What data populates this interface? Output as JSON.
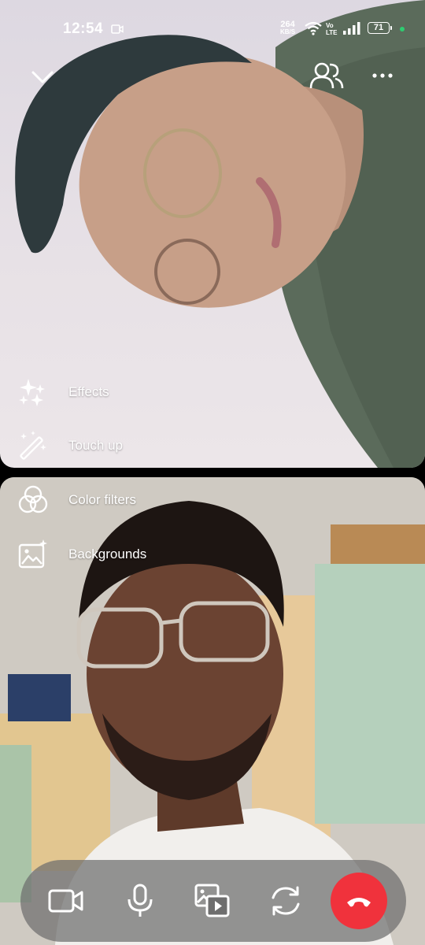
{
  "status_bar": {
    "time": "12:54",
    "speed_value": "264",
    "speed_unit": "KB/S",
    "volte_line1": "Vo",
    "volte_line2": "LTE",
    "battery": "71"
  },
  "top_controls": {
    "collapse_icon": "chevron-down-icon",
    "participants_icon": "participants-icon",
    "more_icon": "more-icon"
  },
  "effects_menu": {
    "items": [
      {
        "label": "Effects",
        "icon": "sparkles-icon"
      },
      {
        "label": "Touch up",
        "icon": "magic-wand-icon"
      },
      {
        "label": "Color filters",
        "icon": "color-filters-icon"
      },
      {
        "label": "Backgrounds",
        "icon": "background-image-icon"
      }
    ]
  },
  "call_controls": {
    "buttons": [
      {
        "icon": "video-camera-icon"
      },
      {
        "icon": "microphone-icon"
      },
      {
        "icon": "media-share-icon"
      },
      {
        "icon": "flip-camera-icon"
      },
      {
        "icon": "end-call-icon"
      }
    ],
    "end_call_color": "#f0323c"
  }
}
